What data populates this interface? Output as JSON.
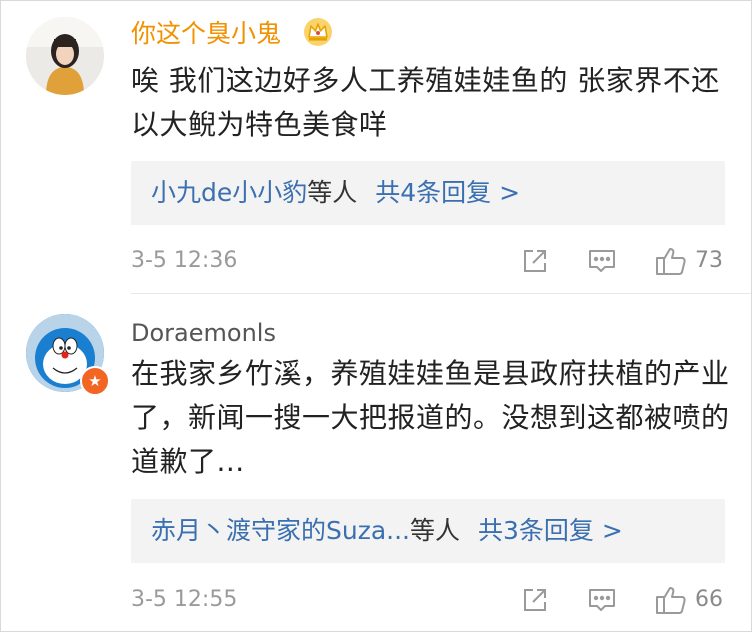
{
  "comments": [
    {
      "username": "你这个臭小鬼",
      "text": "唉 我们这边好多人工养殖娃娃鱼的 张家界不还以大鲵为特色美食咩",
      "replies": {
        "names": "小九de小小豹",
        "suffix": "等人",
        "count": "共4条回复 >"
      },
      "time": "3-5 12:36",
      "likes": "73",
      "icons": {
        "badge": "crown-icon",
        "share": "share-icon",
        "comment": "comment-icon",
        "like": "thumbs-up-icon"
      },
      "colors": {
        "username": "#f29100"
      }
    },
    {
      "username": "Doraemonls",
      "text": "在我家乡竹溪，养殖娃娃鱼是县政府扶植的产业了，新闻一搜一大把报道的。没想到这都被喷的道歉了...",
      "replies": {
        "names": "赤月丶渡守家的Suza...",
        "suffix": "等人",
        "count": "共3条回复 >"
      },
      "time": "3-5 12:55",
      "likes": "66",
      "icons": {
        "badge": "verified-badge-icon",
        "share": "share-icon",
        "comment": "comment-icon",
        "like": "thumbs-up-icon"
      },
      "colors": {
        "username": "#555555"
      }
    }
  ],
  "colors": {
    "link": "#3a6fb0",
    "meta": "#9a9a9a",
    "reply_bg": "#f3f3f3"
  }
}
